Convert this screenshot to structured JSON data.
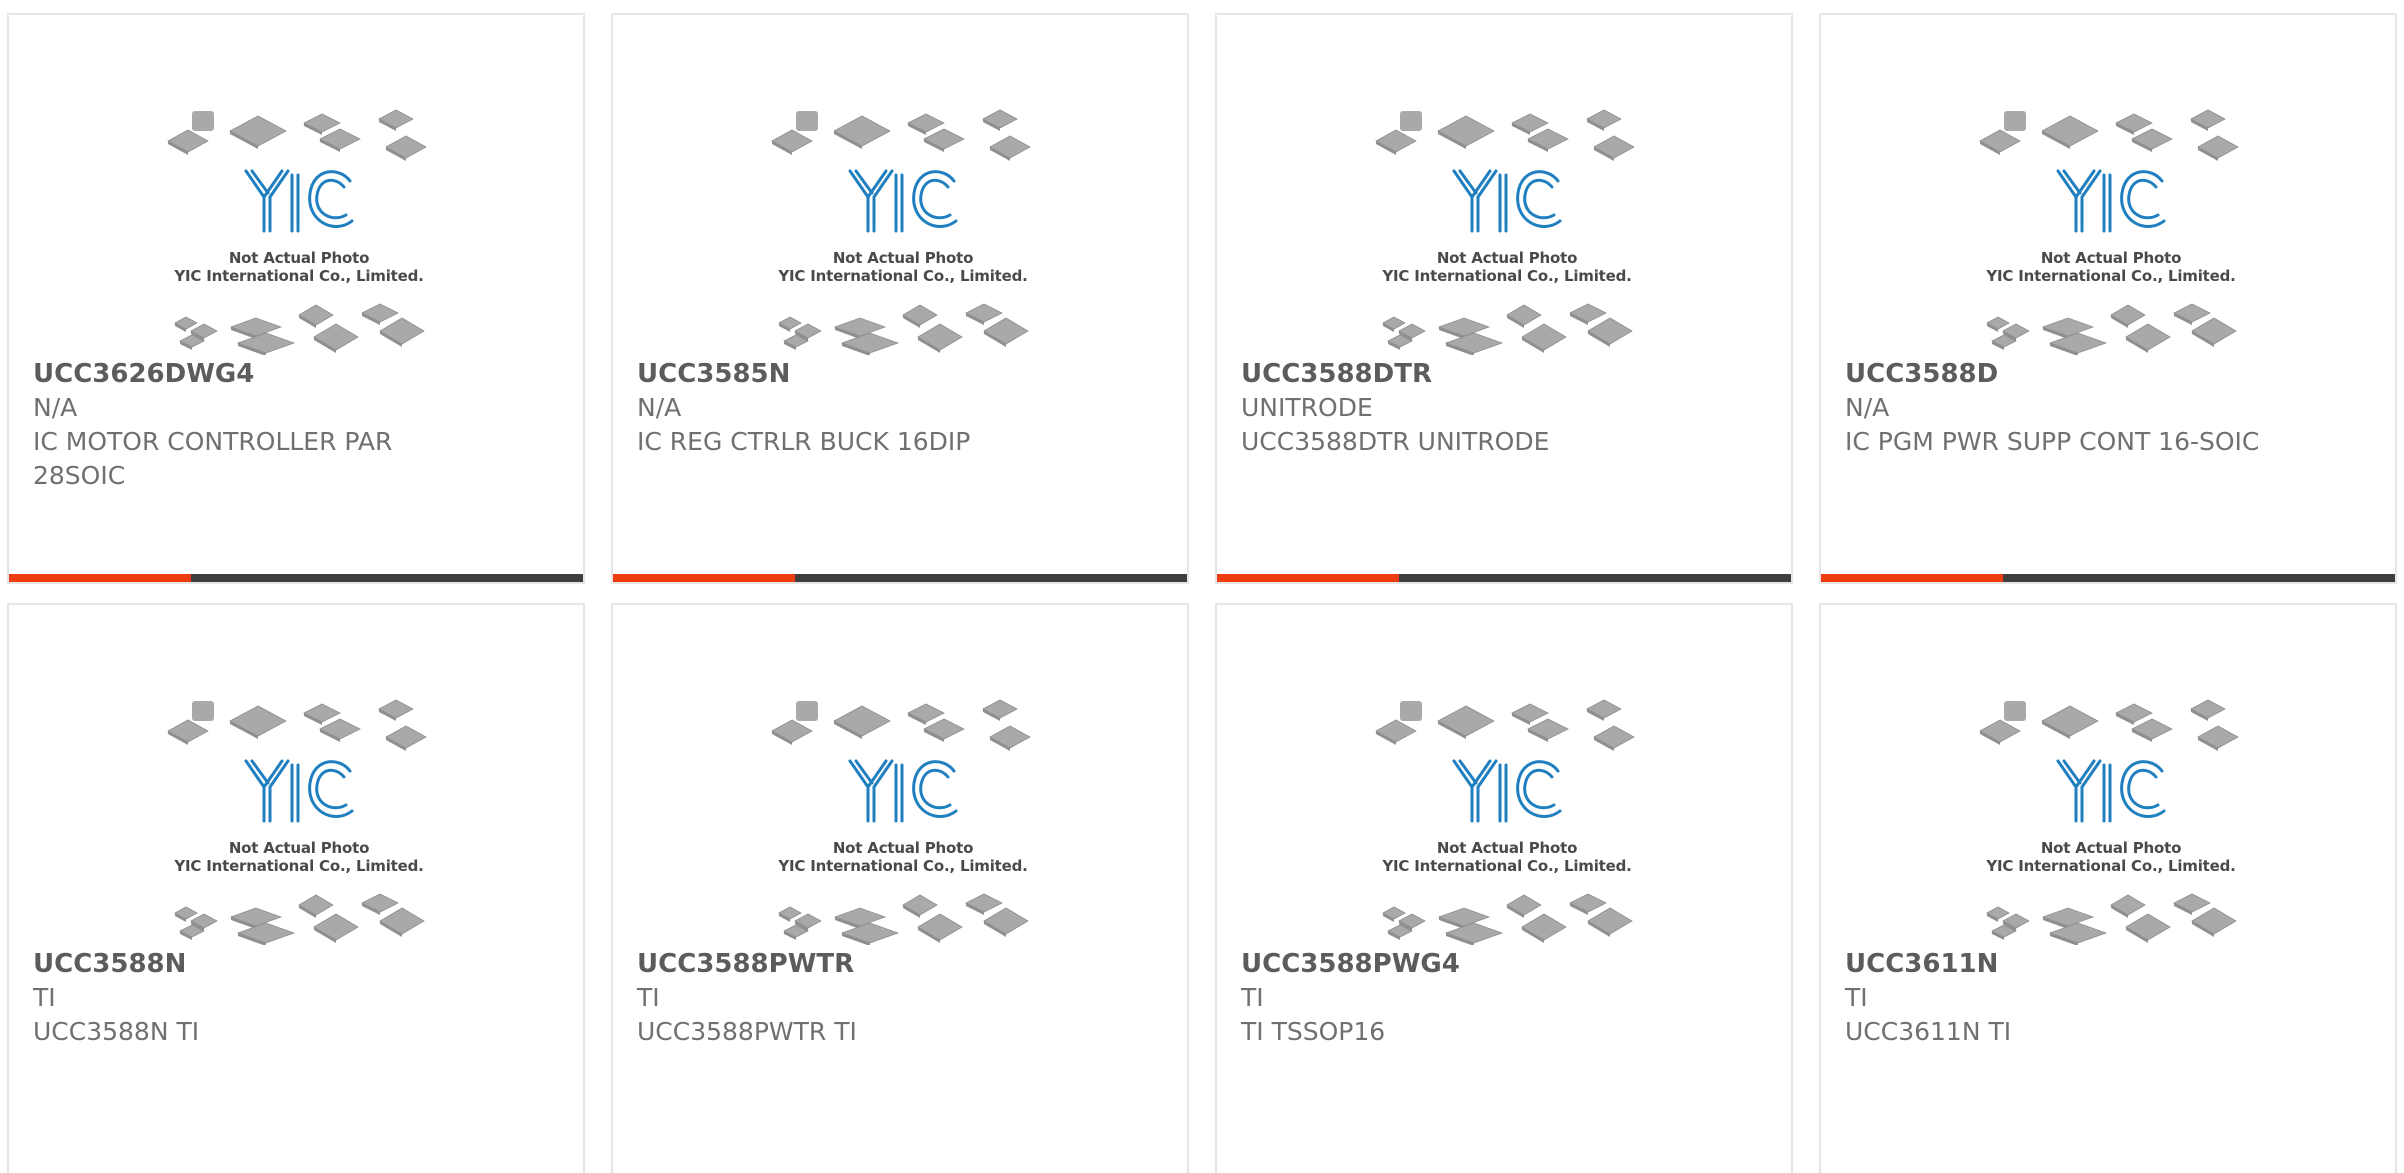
{
  "placeholder": {
    "line1": "Not Actual Photo",
    "line2": "YIC International Co., Limited.",
    "logo_color": "#1f7fc0",
    "chip_color": "#a9a9a9"
  },
  "colors": {
    "accent": "#ee3e0f",
    "bar": "#3f3f3f",
    "border": "#e6e6e6"
  },
  "products": [
    {
      "part": "UCC3626DWG4",
      "maker": "N/A",
      "desc": "IC MOTOR CONTROLLER PAR 28SOIC"
    },
    {
      "part": "UCC3585N",
      "maker": "N/A",
      "desc": "IC REG CTRLR BUCK 16DIP"
    },
    {
      "part": "UCC3588DTR",
      "maker": "UNITRODE",
      "desc": "UCC3588DTR UNITRODE"
    },
    {
      "part": "UCC3588D",
      "maker": "N/A",
      "desc": "IC PGM PWR SUPP CONT 16-SOIC"
    },
    {
      "part": "UCC3588N",
      "maker": "TI",
      "desc": "UCC3588N TI"
    },
    {
      "part": "UCC3588PWTR",
      "maker": "TI",
      "desc": "UCC3588PWTR TI"
    },
    {
      "part": "UCC3588PWG4",
      "maker": "TI",
      "desc": "TI TSSOP16"
    },
    {
      "part": "UCC3611N",
      "maker": "TI",
      "desc": "UCC3611N TI"
    }
  ]
}
